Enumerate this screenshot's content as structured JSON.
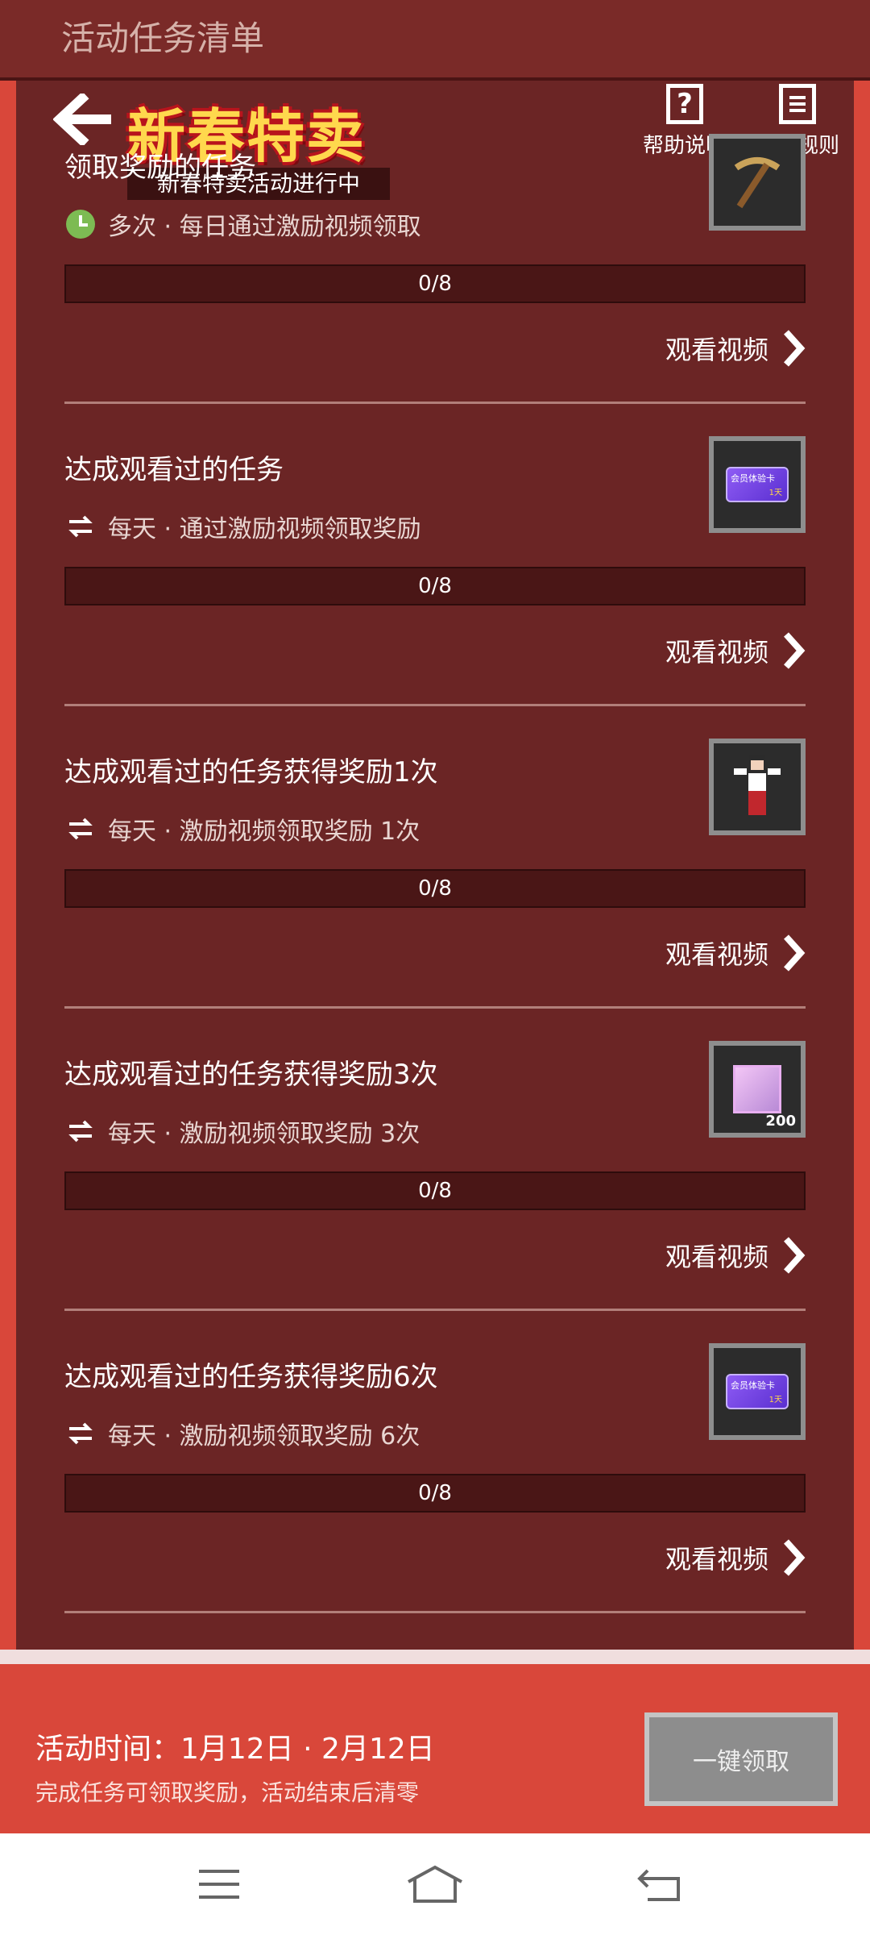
{
  "top_banner": {
    "title": "活动任务清单"
  },
  "header": {
    "logo_text": "新春特卖",
    "subtitle": "新春特卖活动进行中",
    "help_label": "帮助说明",
    "rules_label": "活动规则"
  },
  "tasks": [
    {
      "title": "领取奖励的任务",
      "meta": "多次 · 每日通过激励视频领取",
      "progress_text": "0/8",
      "progress": 0,
      "link_label": "观看视频",
      "icon": "pickaxe-icon"
    },
    {
      "title": "达成观看过的任务",
      "meta": "每天 · 通过激励视频领取奖励",
      "progress_text": "0/8",
      "progress": 0,
      "link_label": "观看视频",
      "icon": "vip-card-icon",
      "card_text": "会员体验卡",
      "card_days": "1天"
    },
    {
      "title": "达成观看过的任务获得奖励1次",
      "meta": "每天 · 激励视频领取奖励 1次",
      "progress_text": "0/8",
      "progress": 0,
      "link_label": "观看视频",
      "icon": "character-skin-icon"
    },
    {
      "title": "达成观看过的任务获得奖励3次",
      "meta": "每天 · 激励视频领取奖励 3次",
      "progress_text": "0/8",
      "progress": 0,
      "link_label": "观看视频",
      "icon": "pink-cube-icon",
      "qty": "200"
    },
    {
      "title": "达成观看过的任务获得奖励6次",
      "meta": "每天 · 激励视频领取奖励 6次",
      "progress_text": "0/8",
      "progress": 0,
      "link_label": "观看视频",
      "icon": "vip-card-icon",
      "card_text": "会员体验卡",
      "card_days": "1天"
    }
  ],
  "bottom": {
    "line1": "活动时间：1月12日 · 2月12日",
    "line2": "完成任务可领取奖励，活动结束后清零",
    "claim_label": "一键领取"
  },
  "colors": {
    "panel": "#6b2525",
    "frame": "#d9473a",
    "logo_fill": "#ffd84d",
    "logo_stroke": "#b8141c"
  }
}
